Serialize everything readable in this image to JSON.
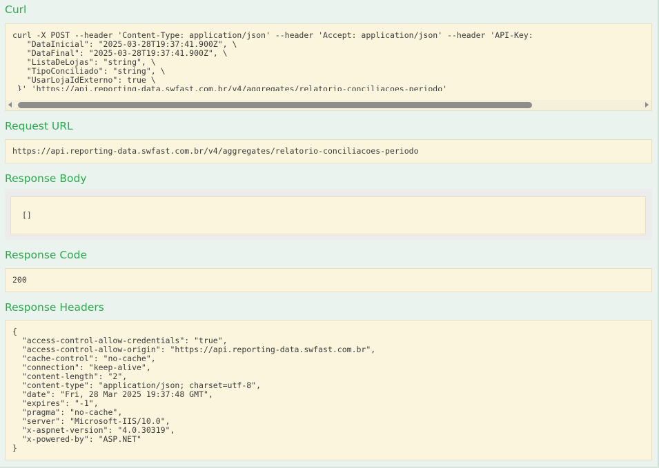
{
  "curl": {
    "title": "Curl",
    "command": "curl -X POST --header 'Content-Type: application/json' --header 'Accept: application/json' --header 'API-Key: \n   \"DataInicial\": \"2025-03-28T19:37:41.900Z\", \\\n   \"DataFinal\": \"2025-03-28T19:37:41.900Z\", \\\n   \"ListaDeLojas\": \"string\", \\\n   \"TipoConciliado\": \"string\", \\\n   \"UsarLojaIdExterno\": true \\\n }' 'https://api.reporting-data.swfast.com.br/v4/aggregates/relatorio-conciliacoes-periodo'"
  },
  "request_url": {
    "title": "Request URL",
    "value": "https://api.reporting-data.swfast.com.br/v4/aggregates/relatorio-conciliacoes-periodo"
  },
  "response_body": {
    "title": "Response Body",
    "value": "[]"
  },
  "response_code": {
    "title": "Response Code",
    "value": "200"
  },
  "response_headers": {
    "title": "Response Headers",
    "value": "{\n  \"access-control-allow-credentials\": \"true\",\n  \"access-control-allow-origin\": \"https://api.reporting-data.swfast.com.br\",\n  \"cache-control\": \"no-cache\",\n  \"connection\": \"keep-alive\",\n  \"content-length\": \"2\",\n  \"content-type\": \"application/json; charset=utf-8\",\n  \"date\": \"Fri, 28 Mar 2025 19:37:48 GMT\",\n  \"expires\": \"-1\",\n  \"pragma\": \"no-cache\",\n  \"server\": \"Microsoft-IIS/10.0\",\n  \"x-aspnet-version\": \"4.0.30319\",\n  \"x-powered-by\": \"ASP.NET\"\n}"
  },
  "colors": {
    "page_background": "#ebf3ee",
    "section_title": "#2ea94f",
    "code_background": "#fbf5dd",
    "code_text": "#3b3b3b"
  }
}
